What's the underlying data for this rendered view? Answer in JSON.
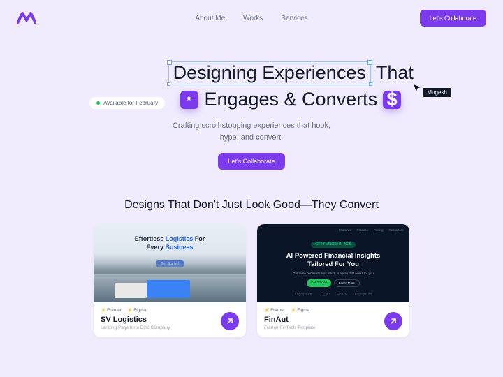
{
  "nav": {
    "about": "About Me",
    "works": "Works",
    "services": "Services"
  },
  "cta": "Let's Collaborate",
  "availability": "Available for February",
  "headline": {
    "line1a": "Designing Experiences",
    "line1b": "That",
    "line2": "Engages & Converts"
  },
  "cursor_name": "Mugesh",
  "subtitle": "Crafting scroll-stopping experiences that hook,\nhype, and convert.",
  "works_title": "Designs That Don't Just Look Good—They Convert",
  "cards": [
    {
      "thumb_line1a": "Effortless ",
      "thumb_line1b": "Logistics",
      "thumb_line1c": " For",
      "thumb_line2a": "Every ",
      "thumb_line2b": "Business",
      "tags": [
        "Framer",
        "Figma"
      ],
      "title": "SV Logistics",
      "sub": "Landing Page for a D2C Company"
    },
    {
      "thumb_pill": "GET FUNDED IN 2025",
      "thumb_nav": [
        "Features",
        "Process",
        "Pricing",
        "Resources"
      ],
      "thumb_title": "AI Powered Financial Insights\nTailored For You",
      "thumb_sub": "Get more done with less effort, in a way that works for you",
      "thumb_btn1": "Get Started",
      "thumb_btn2": "Learn More",
      "thumb_logos": [
        "Logoipsum",
        "LO▢O",
        "IPSUM",
        "Logoipsum"
      ],
      "tags": [
        "Framer",
        "Figma"
      ],
      "title": "FinAut",
      "sub": "Framer FinTech Template"
    }
  ]
}
